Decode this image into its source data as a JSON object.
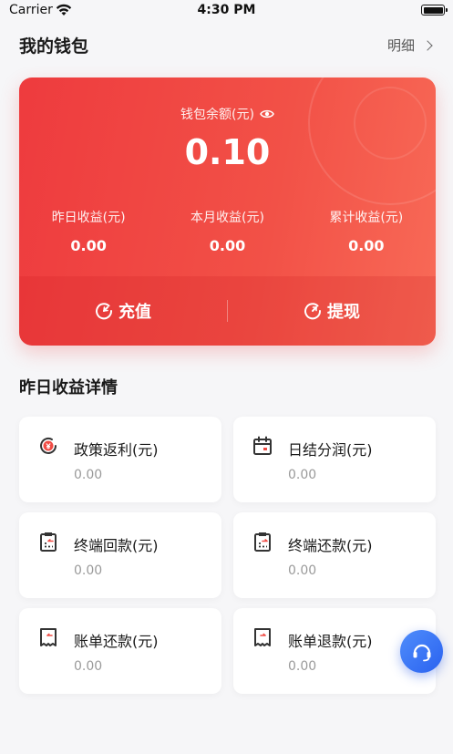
{
  "status_bar": {
    "carrier": "Carrier",
    "time": "4:30 PM"
  },
  "header": {
    "title": "我的钱包",
    "detail_link": "明细"
  },
  "wallet": {
    "balance_label": "钱包余额(元)",
    "balance_value": "0.10",
    "stats": [
      {
        "label": "昨日收益(元)",
        "value": "0.00"
      },
      {
        "label": "本月收益(元)",
        "value": "0.00"
      },
      {
        "label": "累计收益(元)",
        "value": "0.00"
      }
    ],
    "actions": {
      "recharge": "充值",
      "withdraw": "提现"
    },
    "colors": {
      "card_start": "#ee3b3e",
      "card_end": "#f86a57"
    }
  },
  "section": {
    "title": "昨日收益详情"
  },
  "tiles": [
    {
      "icon": "rebate-icon",
      "label": "政策返利(元)",
      "value": "0.00"
    },
    {
      "icon": "calendar-icon",
      "label": "日结分润(元)",
      "value": "0.00"
    },
    {
      "icon": "terminal-return-icon",
      "label": "终端回款(元)",
      "value": "0.00"
    },
    {
      "icon": "terminal-repay-icon",
      "label": "终端还款(元)",
      "value": "0.00"
    },
    {
      "icon": "bill-repay-icon",
      "label": "账单还款(元)",
      "value": "0.00"
    },
    {
      "icon": "bill-refund-icon",
      "label": "账单退款(元)",
      "value": "0.00"
    }
  ],
  "fab": {
    "icon": "headset-icon",
    "color": "#2a62f0"
  }
}
